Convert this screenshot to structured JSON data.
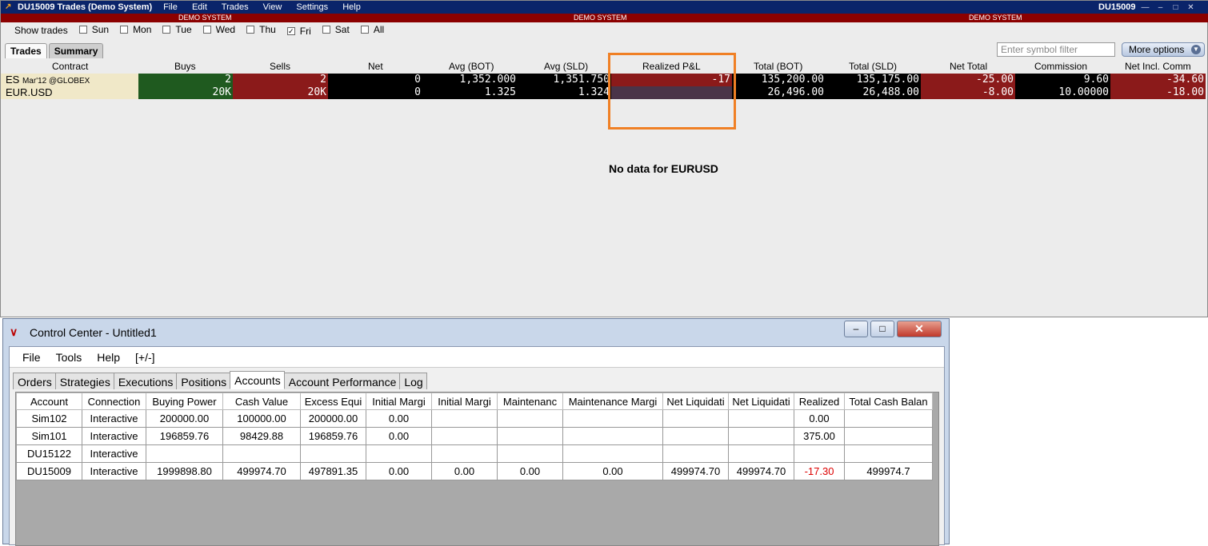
{
  "tws": {
    "title": "DU15009 Trades (Demo System)",
    "menu": [
      "File",
      "Edit",
      "Trades",
      "View",
      "Settings",
      "Help"
    ],
    "account": "DU15009",
    "demo_label": "DEMO SYSTEM",
    "filter": {
      "label": "Show trades",
      "days": [
        {
          "label": "Sun",
          "checked": false
        },
        {
          "label": "Mon",
          "checked": false
        },
        {
          "label": "Tue",
          "checked": false
        },
        {
          "label": "Wed",
          "checked": false
        },
        {
          "label": "Thu",
          "checked": false
        },
        {
          "label": "Fri",
          "checked": true
        },
        {
          "label": "Sat",
          "checked": false
        },
        {
          "label": "All",
          "checked": false
        }
      ]
    },
    "tabs": [
      "Trades",
      "Summary"
    ],
    "symbol_filter_placeholder": "Enter symbol filter",
    "more_options_label": "More options",
    "columns": [
      "Contract",
      "Buys",
      "Sells",
      "Net",
      "Avg (BOT)",
      "Avg (SLD)",
      "Realized P&L",
      "Total (BOT)",
      "Total (SLD)",
      "Net Total",
      "Commission",
      "Net Incl. Comm"
    ],
    "rows": [
      {
        "contract": "ES",
        "contract_detail": "Mar'12 @GLOBEX",
        "buys": "2",
        "sells": "2",
        "net": "0",
        "avg_bot": "1,352.000",
        "avg_sld": "1,351.750",
        "realized_pnl": "-17",
        "total_bot": "135,200.00",
        "total_sld": "135,175.00",
        "net_total": "-25.00",
        "commission": "9.60",
        "net_incl_comm": "-34.60"
      },
      {
        "contract": "EUR.USD",
        "contract_detail": "",
        "buys": "20K",
        "sells": "20K",
        "net": "0",
        "avg_bot": "1.325",
        "avg_sld": "1.324",
        "realized_pnl": "",
        "total_bot": "26,496.00",
        "total_sld": "26,488.00",
        "net_total": "-8.00",
        "commission": "10.00000",
        "net_incl_comm": "-18.00"
      }
    ],
    "annotation": "No data for EURUSD",
    "colors": {
      "green": "#1f5a1f",
      "red": "#8b1a1a",
      "black": "#000000",
      "highlight": "#f08025"
    }
  },
  "control_center": {
    "title": "Control Center - Untitled1",
    "menu": [
      "File",
      "Tools",
      "Help",
      "[+/-]"
    ],
    "tabs": [
      "Orders",
      "Strategies",
      "Executions",
      "Positions",
      "Accounts",
      "Account Performance",
      "Log"
    ],
    "active_tab": "Accounts",
    "columns": [
      "Account",
      "Connection",
      "Buying Power",
      "Cash Value",
      "Excess Equi",
      "Initial Margi",
      "Initial Margi",
      "Maintenanc",
      "Maintenance Margi",
      "Net Liquidati",
      "Net Liquidati",
      "Realized",
      "Total Cash Balan"
    ],
    "rows": [
      [
        "Sim102",
        "Interactive",
        "200000.00",
        "100000.00",
        "200000.00",
        "0.00",
        "",
        "",
        "",
        "",
        "",
        "0.00",
        ""
      ],
      [
        "Sim101",
        "Interactive",
        "196859.76",
        "98429.88",
        "196859.76",
        "0.00",
        "",
        "",
        "",
        "",
        "",
        "375.00",
        ""
      ],
      [
        "DU15122",
        "Interactive",
        "",
        "",
        "",
        "",
        "",
        "",
        "",
        "",
        "",
        "",
        ""
      ],
      [
        "DU15009",
        "Interactive",
        "1999898.80",
        "499974.70",
        "497891.35",
        "0.00",
        "0.00",
        "0.00",
        "0.00",
        "499974.70",
        "499974.70",
        "-17.30",
        "499974.7"
      ]
    ]
  }
}
